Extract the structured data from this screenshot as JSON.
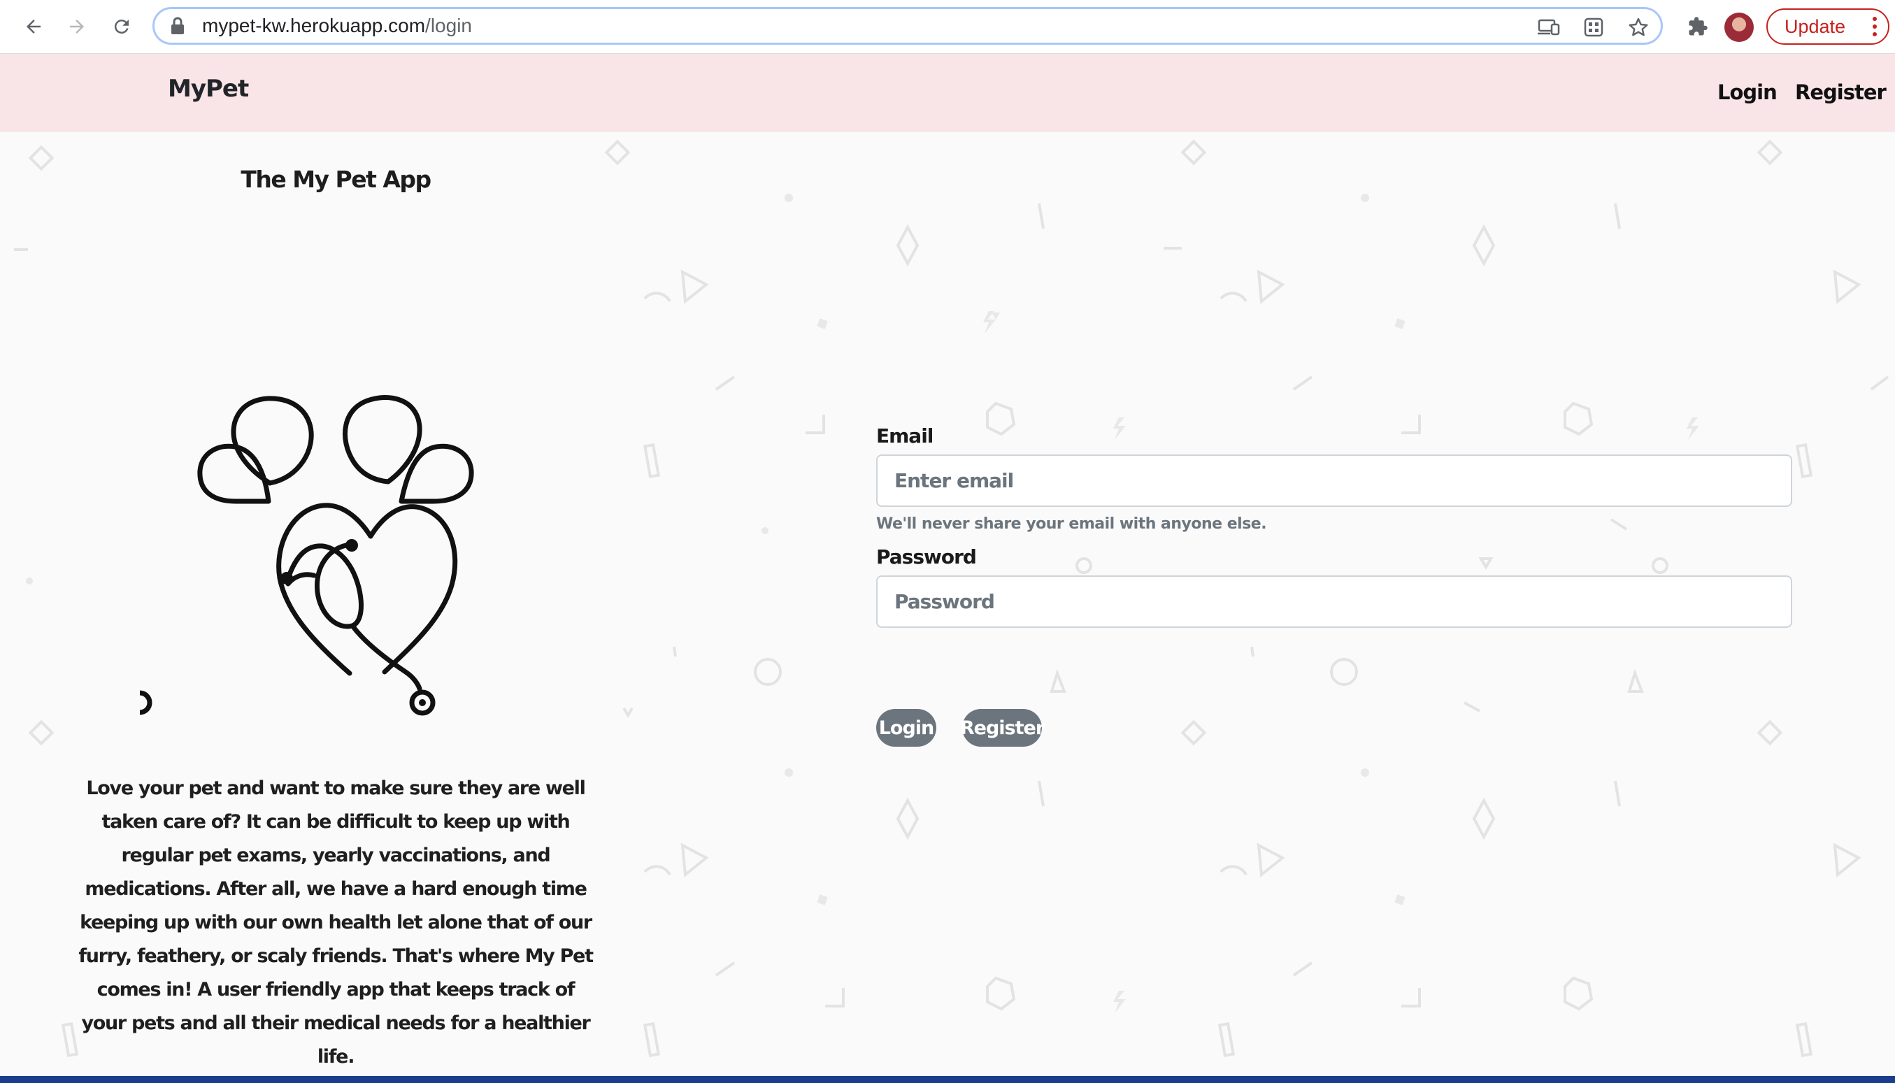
{
  "browser": {
    "url_host": "mypet-kw.herokuapp.com",
    "url_path": "/login",
    "update_label": "Update"
  },
  "navbar": {
    "brand": "MyPet",
    "links": [
      "Login",
      "Register"
    ]
  },
  "hero": {
    "title": "The My Pet App",
    "description": "Love your pet and want to make sure they are well taken care of? It can be difficult to keep up with regular pet exams, yearly vaccinations, and medications. After all, we have a hard enough time keeping up with our own health let alone that of our furry, feathery, or scaly friends. That's where My Pet comes in! A user friendly app that keeps track of your pets and all their medical needs for a healthier life."
  },
  "form": {
    "email_label": "Email",
    "email_placeholder": "Enter email",
    "email_help": "We'll never share your email with anyone else.",
    "password_label": "Password",
    "password_placeholder": "Password",
    "login_button": "Login",
    "register_button": "Register"
  },
  "colors": {
    "navbar_bg": "#f9e5e7",
    "button_bg": "#6c757d",
    "update_accent": "#c5221f"
  }
}
